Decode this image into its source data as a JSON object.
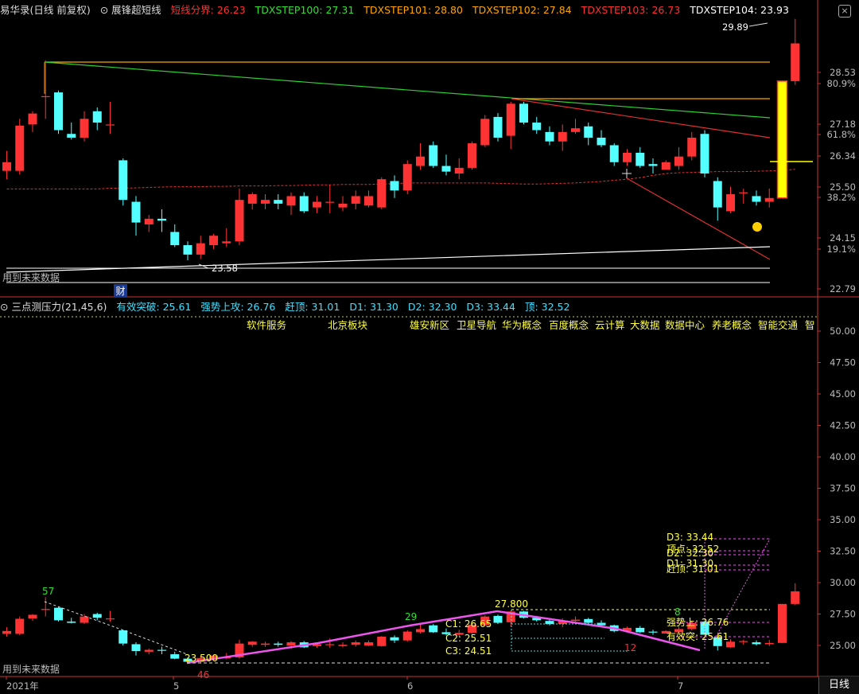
{
  "app": {
    "title": "易华录(日线 前复权)",
    "indicator_name": "展锋超短线"
  },
  "legend_top": [
    {
      "label": "短线分界: 26.23",
      "color": "#ff3030"
    },
    {
      "label": "TDXSTEP100: 27.31",
      "color": "#30e030"
    },
    {
      "label": "TDXSTEP101: 28.80",
      "color": "#ffa500"
    },
    {
      "label": "TDXSTEP102: 27.84",
      "color": "#ffa500"
    },
    {
      "label": "TDXSTEP103: 26.73",
      "color": "#ff3030"
    },
    {
      "label": "TDXSTEP104: 23.93",
      "color": "#ffffff"
    }
  ],
  "legend_bottom": {
    "indicator": "三点测压力(21,45,6)",
    "items": [
      {
        "label": "有效突破: 25.61",
        "color": "#40e0ff"
      },
      {
        "label": "强势上攻: 26.76",
        "color": "#40e0ff"
      },
      {
        "label": "赶顶: 31.01",
        "color": "#40e0ff"
      },
      {
        "label": "D1: 31.30",
        "color": "#40e0ff"
      },
      {
        "label": "D2: 32.30",
        "color": "#40e0ff"
      },
      {
        "label": "D3: 33.44",
        "color": "#40e0ff"
      },
      {
        "label": "顶: 32.52",
        "color": "#40e0ff"
      }
    ]
  },
  "sectors": [
    "软件服务",
    "北京板块",
    "雄安新区",
    "卫星导航",
    "华为概念",
    "百度概念",
    "云计算",
    "大数据",
    "数据中心",
    "养老概念",
    "智能交通",
    "智"
  ],
  "future_data_label": "用到未来数据",
  "finance_label": "财",
  "period_tab": "日线",
  "chart_data": {
    "type": "candlestick",
    "up_color": "#ff3333",
    "down_color": "#54ffff",
    "x_ticks": [
      "2021年",
      "5",
      "6",
      "7"
    ],
    "upper_axis": {
      "ylim": [
        22.4,
        30.2
      ],
      "ticks": [
        "28.53",
        "80.9%",
        "27.18",
        "61.8%",
        "26.34",
        "25.50",
        "38.2%",
        "24.15",
        "19.1%",
        "22.79"
      ]
    },
    "lower_axis": {
      "ylim": [
        23.8,
        51.8
      ],
      "ticks": [
        "50.00",
        "47.50",
        "45.00",
        "42.50",
        "40.00",
        "37.50",
        "35.00",
        "32.50",
        "30.00",
        "27.50",
        "25.00"
      ]
    },
    "candles": [
      {
        "o": 25.92,
        "h": 26.45,
        "l": 25.7,
        "c": 26.15
      },
      {
        "o": 25.92,
        "h": 27.3,
        "l": 25.82,
        "c": 27.12
      },
      {
        "o": 27.15,
        "h": 27.5,
        "l": 26.95,
        "c": 27.44
      },
      {
        "o": 27.9,
        "h": 28.85,
        "l": 27.3,
        "c": 27.9
      },
      {
        "o": 28.0,
        "h": 28.05,
        "l": 26.9,
        "c": 27.0
      },
      {
        "o": 26.9,
        "h": 27.2,
        "l": 26.75,
        "c": 26.8
      },
      {
        "o": 26.8,
        "h": 27.5,
        "l": 26.7,
        "c": 27.3
      },
      {
        "o": 27.5,
        "h": 27.6,
        "l": 27.0,
        "c": 27.2
      },
      {
        "o": 27.15,
        "h": 27.75,
        "l": 26.9,
        "c": 27.15
      },
      {
        "o": 26.2,
        "h": 26.25,
        "l": 25.0,
        "c": 25.15
      },
      {
        "o": 25.1,
        "h": 25.25,
        "l": 24.2,
        "c": 24.55
      },
      {
        "o": 24.5,
        "h": 24.75,
        "l": 24.3,
        "c": 24.65
      },
      {
        "o": 24.65,
        "h": 24.9,
        "l": 24.3,
        "c": 24.6
      },
      {
        "o": 24.3,
        "h": 24.5,
        "l": 23.9,
        "c": 23.95
      },
      {
        "o": 23.95,
        "h": 24.05,
        "l": 23.55,
        "c": 23.7
      },
      {
        "o": 23.7,
        "h": 24.2,
        "l": 23.58,
        "c": 24.0
      },
      {
        "o": 23.95,
        "h": 24.25,
        "l": 23.85,
        "c": 24.2
      },
      {
        "o": 24.0,
        "h": 24.4,
        "l": 23.9,
        "c": 24.05
      },
      {
        "o": 24.05,
        "h": 25.45,
        "l": 23.95,
        "c": 25.15
      },
      {
        "o": 25.05,
        "h": 25.35,
        "l": 24.9,
        "c": 25.3
      },
      {
        "o": 25.05,
        "h": 25.3,
        "l": 24.9,
        "c": 25.15
      },
      {
        "o": 25.15,
        "h": 25.3,
        "l": 24.9,
        "c": 25.05
      },
      {
        "o": 25.0,
        "h": 25.35,
        "l": 24.75,
        "c": 25.25
      },
      {
        "o": 25.25,
        "h": 25.35,
        "l": 24.8,
        "c": 24.85
      },
      {
        "o": 24.95,
        "h": 25.25,
        "l": 24.8,
        "c": 25.1
      },
      {
        "o": 25.1,
        "h": 25.55,
        "l": 24.8,
        "c": 25.1
      },
      {
        "o": 24.95,
        "h": 25.25,
        "l": 24.85,
        "c": 25.05
      },
      {
        "o": 25.05,
        "h": 25.4,
        "l": 24.9,
        "c": 25.25
      },
      {
        "o": 25.0,
        "h": 25.4,
        "l": 24.95,
        "c": 25.25
      },
      {
        "o": 24.95,
        "h": 25.75,
        "l": 24.9,
        "c": 25.7
      },
      {
        "o": 25.65,
        "h": 25.8,
        "l": 25.2,
        "c": 25.4
      },
      {
        "o": 25.4,
        "h": 26.2,
        "l": 25.3,
        "c": 26.1
      },
      {
        "o": 26.05,
        "h": 26.65,
        "l": 25.95,
        "c": 26.3
      },
      {
        "o": 26.6,
        "h": 26.7,
        "l": 26.0,
        "c": 26.05
      },
      {
        "o": 26.05,
        "h": 26.35,
        "l": 25.8,
        "c": 25.9
      },
      {
        "o": 25.85,
        "h": 26.25,
        "l": 25.7,
        "c": 26.0
      },
      {
        "o": 26.0,
        "h": 26.7,
        "l": 25.95,
        "c": 26.65
      },
      {
        "o": 26.6,
        "h": 27.4,
        "l": 26.55,
        "c": 27.3
      },
      {
        "o": 27.35,
        "h": 27.45,
        "l": 26.7,
        "c": 26.8
      },
      {
        "o": 26.85,
        "h": 27.75,
        "l": 26.5,
        "c": 27.7
      },
      {
        "o": 27.7,
        "h": 27.75,
        "l": 27.15,
        "c": 27.2
      },
      {
        "o": 27.2,
        "h": 27.35,
        "l": 26.9,
        "c": 27.0
      },
      {
        "o": 26.95,
        "h": 27.1,
        "l": 26.6,
        "c": 26.7
      },
      {
        "o": 26.7,
        "h": 27.15,
        "l": 26.45,
        "c": 26.95
      },
      {
        "o": 26.95,
        "h": 27.3,
        "l": 26.9,
        "c": 27.05
      },
      {
        "o": 27.1,
        "h": 27.2,
        "l": 26.6,
        "c": 26.8
      },
      {
        "o": 26.8,
        "h": 27.0,
        "l": 26.55,
        "c": 26.6
      },
      {
        "o": 26.6,
        "h": 26.65,
        "l": 26.05,
        "c": 26.15
      },
      {
        "o": 26.15,
        "h": 26.5,
        "l": 26.05,
        "c": 26.4
      },
      {
        "o": 26.4,
        "h": 26.55,
        "l": 26.0,
        "c": 26.05
      },
      {
        "o": 26.1,
        "h": 26.25,
        "l": 25.85,
        "c": 26.05
      },
      {
        "o": 25.95,
        "h": 26.2,
        "l": 25.95,
        "c": 26.15
      },
      {
        "o": 26.05,
        "h": 26.55,
        "l": 25.95,
        "c": 26.3
      },
      {
        "o": 26.3,
        "h": 26.95,
        "l": 26.2,
        "c": 26.8
      },
      {
        "o": 26.9,
        "h": 27.0,
        "l": 25.75,
        "c": 25.85
      },
      {
        "o": 25.65,
        "h": 25.75,
        "l": 24.6,
        "c": 24.95
      },
      {
        "o": 24.85,
        "h": 25.5,
        "l": 24.8,
        "c": 25.3
      },
      {
        "o": 25.35,
        "h": 25.45,
        "l": 25.05,
        "c": 25.35
      },
      {
        "o": 25.25,
        "h": 25.4,
        "l": 25.0,
        "c": 25.1
      },
      {
        "o": 25.1,
        "h": 25.45,
        "l": 24.95,
        "c": 25.2
      },
      {
        "o": 25.2,
        "h": 28.3,
        "l": 25.2,
        "c": 28.3
      },
      {
        "o": 28.3,
        "h": 29.95,
        "l": 28.2,
        "c": 29.3
      }
    ],
    "ma_line_values": [
      25.44,
      25.44,
      25.44,
      25.44,
      25.44,
      25.44,
      25.44,
      25.44,
      25.46,
      25.46,
      25.47,
      25.48,
      25.49,
      25.5,
      25.5,
      25.5,
      25.51,
      25.51,
      25.52,
      25.52,
      25.52,
      25.53,
      25.53,
      25.54,
      25.55,
      25.55,
      25.56,
      25.56,
      25.56,
      25.57,
      25.58,
      25.6,
      25.6,
      25.6,
      25.6,
      25.6,
      25.6,
      25.6,
      25.59,
      25.58,
      25.57,
      25.57,
      25.58,
      25.59,
      25.6,
      25.62,
      25.64,
      25.67,
      25.7,
      25.74,
      25.8,
      25.85,
      25.87,
      25.88,
      25.89,
      25.9,
      25.9,
      25.9,
      25.91,
      25.92,
      25.93,
      25.96
    ],
    "upper_annotations": [
      {
        "text": "29.89",
        "color": "#ffffff"
      },
      {
        "text": "23.58",
        "color": "#ffffff"
      }
    ],
    "lower_annotations": [
      {
        "text": "57",
        "color": "#30e030"
      },
      {
        "text": "23.500",
        "color": "#ffff40"
      },
      {
        "text": "46",
        "color": "#ff3030"
      },
      {
        "text": "29",
        "color": "#30e030"
      },
      {
        "text": "27.800",
        "color": "#ffff40"
      },
      {
        "text": "C1: 26.65",
        "color": "#ffff40"
      },
      {
        "text": "C2: 25.51",
        "color": "#ffff40"
      },
      {
        "text": "C3: 24.51",
        "color": "#ffff40"
      },
      {
        "text": "12",
        "color": "#ff3030"
      },
      {
        "text": "8",
        "color": "#30e030"
      },
      {
        "text": "强势上: 26.76",
        "color": "#ffff40"
      },
      {
        "text": "有效突: 25.61",
        "color": "#ffff40"
      },
      {
        "text": "D3: 33.44",
        "color": "#ffff40"
      },
      {
        "text": "顶点: 32.52",
        "color": "#ffff40"
      },
      {
        "text": "D2: 32.30",
        "color": "#ffff40"
      },
      {
        "text": "D1: 31.30",
        "color": "#ffff40"
      },
      {
        "text": "赶顶: 31.01",
        "color": "#ffff40"
      }
    ]
  }
}
